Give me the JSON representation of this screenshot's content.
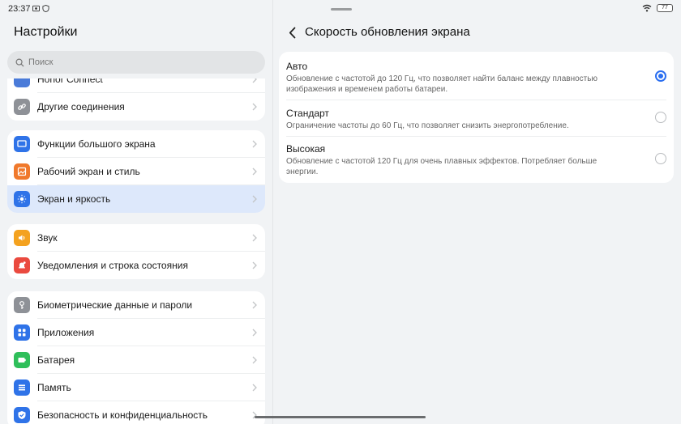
{
  "status_bar": {
    "time": "23:37",
    "battery_level": "77"
  },
  "left": {
    "title": "Настройки",
    "search": {
      "placeholder": "Поиск",
      "icon": "search-icon"
    },
    "groups": [
      {
        "items": [
          {
            "label": "Honor Connect",
            "icon": "honor-connect-icon",
            "color": "#4a7bd9"
          },
          {
            "label": "Другие соединения",
            "icon": "link-icon",
            "color": "#8e9197"
          }
        ]
      },
      {
        "items": [
          {
            "label": "Функции большого экрана",
            "icon": "monitor-icon",
            "color": "#2f73e8"
          },
          {
            "label": "Рабочий экран и стиль",
            "icon": "image-icon",
            "color": "#f0792c"
          },
          {
            "label": "Экран и яркость",
            "icon": "brightness-icon",
            "color": "#2f73e8",
            "selected": true
          }
        ]
      },
      {
        "items": [
          {
            "label": "Звук",
            "icon": "speaker-icon",
            "color": "#f4a21f"
          },
          {
            "label": "Уведомления и строка состояния",
            "icon": "bell-icon",
            "color": "#ea4a3f"
          }
        ]
      },
      {
        "items": [
          {
            "label": "Биометрические данные и пароли",
            "icon": "key-icon",
            "color": "#8e9197"
          },
          {
            "label": "Приложения",
            "icon": "apps-grid-icon",
            "color": "#2f73e8"
          },
          {
            "label": "Батарея",
            "icon": "battery-icon",
            "color": "#2fbf5a"
          },
          {
            "label": "Память",
            "icon": "storage-icon",
            "color": "#2f73e8"
          },
          {
            "label": "Безопасность и конфиденциальность",
            "icon": "shield-check-icon",
            "color": "#2f73e8"
          }
        ]
      }
    ]
  },
  "right": {
    "title": "Скорость обновления экрана",
    "options": [
      {
        "title": "Авто",
        "description": "Обновление с частотой до 120 Гц, что позволяет найти баланс между плавностью изображения и временем работы батареи.",
        "selected": true
      },
      {
        "title": "Стандарт",
        "description": "Ограничение частоты до 60 Гц, что позволяет снизить энергопотребление.",
        "selected": false
      },
      {
        "title": "Высокая",
        "description": "Обновление с частотой 120 Гц для очень плавных эффектов. Потребляет больше энергии.",
        "selected": false
      }
    ]
  },
  "colors": {
    "accent": "#2a6ef0",
    "selected_row": "#dde8fb"
  }
}
